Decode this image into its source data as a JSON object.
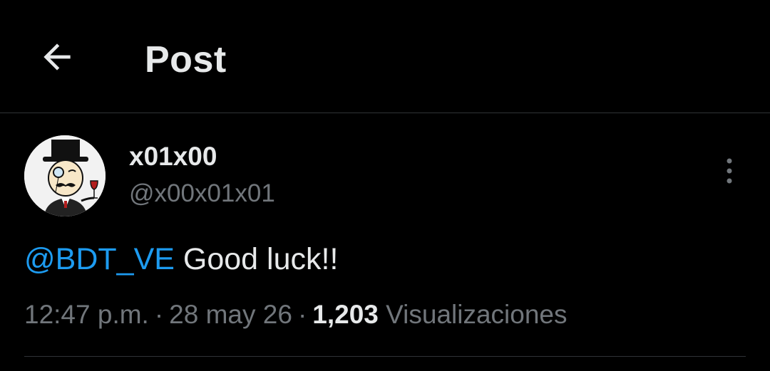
{
  "header": {
    "title": "Post",
    "back_icon": "arrow-left-icon"
  },
  "post": {
    "author": {
      "display_name": "x01x00",
      "handle": "@x00x01x01",
      "avatar_icon": "monocle-gentleman-avatar"
    },
    "more_icon": "more-vertical-icon",
    "mention": "@BDT_VE",
    "text": "Good luck!!",
    "time": "12:47 p.m.",
    "separator": "·",
    "date": "28 may 26",
    "views_count": "1,203",
    "views_label": "Visualizaciones"
  },
  "colors": {
    "background": "#000000",
    "text_primary": "#e7e9ea",
    "text_secondary": "#71767b",
    "accent": "#1d9bf0",
    "divider": "#2f3336"
  }
}
